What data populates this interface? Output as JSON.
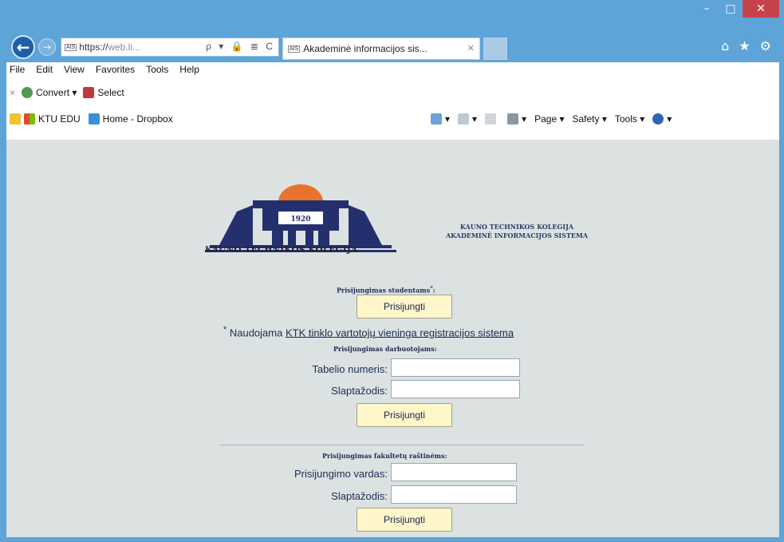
{
  "window": {
    "minimize": "–",
    "maximize": "□",
    "close": "✕"
  },
  "nav": {
    "address_badge": "AIS",
    "address_url_main": "https://",
    "address_url_dim": "web.li...",
    "address_tools": "ρ ▾ 🔒 ≣ C",
    "tab_badge": "AIS",
    "tab_title": "Akademinė informacijos sis...",
    "tab_close": "✕",
    "right_icons": [
      "⌂",
      "★",
      "⚙"
    ]
  },
  "menu": [
    "File",
    "Edit",
    "View",
    "Favorites",
    "Tools",
    "Help"
  ],
  "command_bar": {
    "close": "×",
    "convert": "Convert",
    "select": "Select"
  },
  "favorites_bar": {
    "items": [
      "KTU EDU",
      "Home - Dropbox"
    ],
    "right_items": [
      "Page ▾",
      "Safety ▾",
      "Tools ▾"
    ]
  },
  "brand": {
    "year": "1920",
    "name": "KAUNO TECHNIKOS KOLEGIJA",
    "system_line1": "KAUNO TECHNIKOS KOLEGIJA",
    "system_line2": "AKADEMINĖ INFORMACIJOS SISTEMA"
  },
  "students": {
    "heading": "Prisijungimas studentams",
    "heading_mark": "*",
    "button": "Prisijungti",
    "note_prefix": "Naudojama",
    "note_link": "KTK tinklo vartotojų vieninga registracijos sistema"
  },
  "staff": {
    "heading": "Prisijungimas darbuotojams:",
    "id_label": "Tabelio numeris:",
    "password_label": "Slaptažodis:",
    "button": "Prisijungti"
  },
  "faculty": {
    "heading": "Prisijungimas fakultetų raštinėms:",
    "login_label": "Prisijungimo vardas:",
    "password_label": "Slaptažodis:",
    "button": "Prisijungti"
  }
}
